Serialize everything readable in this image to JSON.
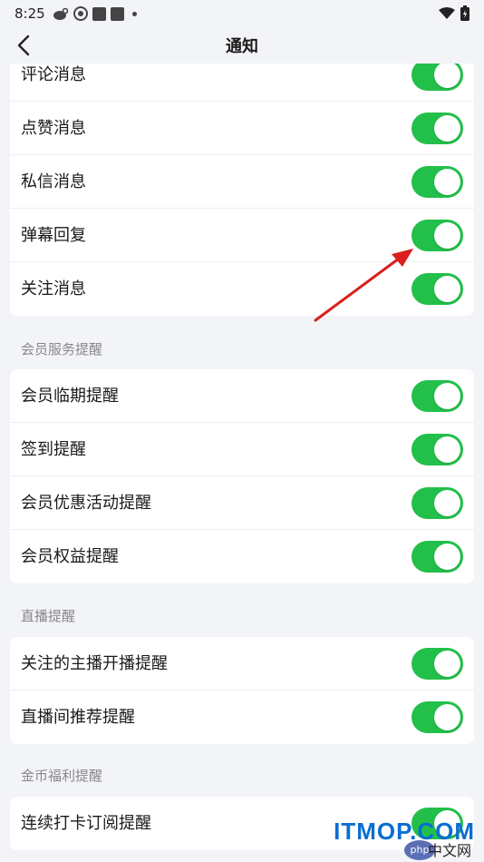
{
  "status_bar": {
    "time": "8:25"
  },
  "header": {
    "title": "通知"
  },
  "sections": [
    {
      "title": "",
      "items": [
        {
          "label": "评论消息",
          "enabled": true
        },
        {
          "label": "点赞消息",
          "enabled": true
        },
        {
          "label": "私信消息",
          "enabled": true
        },
        {
          "label": "弹幕回复",
          "enabled": true
        },
        {
          "label": "关注消息",
          "enabled": true
        }
      ]
    },
    {
      "title": "会员服务提醒",
      "items": [
        {
          "label": "会员临期提醒",
          "enabled": true
        },
        {
          "label": "签到提醒",
          "enabled": true
        },
        {
          "label": "会员优惠活动提醒",
          "enabled": true
        },
        {
          "label": "会员权益提醒",
          "enabled": true
        }
      ]
    },
    {
      "title": "直播提醒",
      "items": [
        {
          "label": "关注的主播开播提醒",
          "enabled": true
        },
        {
          "label": "直播间推荐提醒",
          "enabled": true
        }
      ]
    },
    {
      "title": "金币福利提醒",
      "items": [
        {
          "label": "连续打卡订阅提醒",
          "enabled": true
        }
      ]
    }
  ],
  "colors": {
    "toggle_on": "#22c04a",
    "background": "#f2f4f8",
    "annotation_arrow": "#d9201f"
  },
  "watermark": {
    "logo": "php",
    "site": "ITMOP.COM",
    "tag": "中文网"
  }
}
